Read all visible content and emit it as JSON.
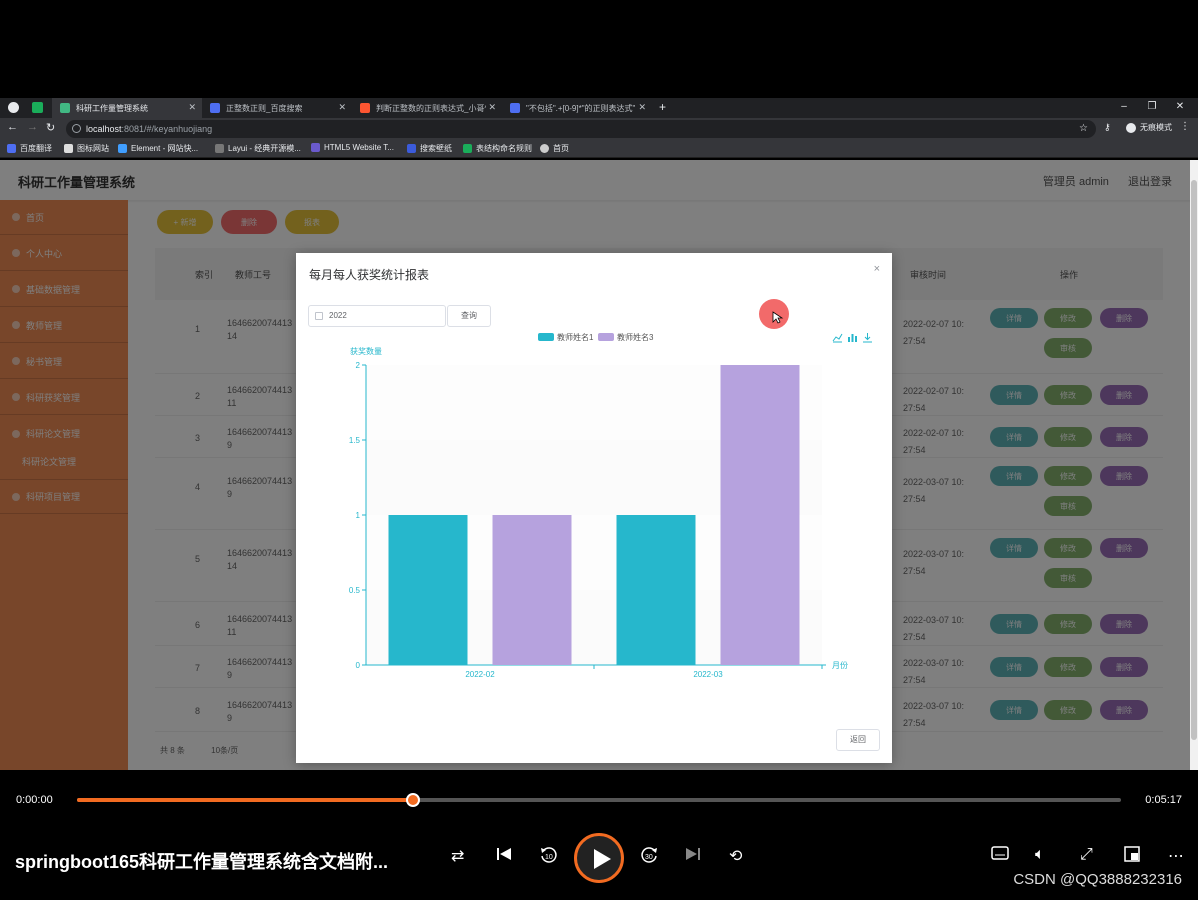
{
  "browser": {
    "tabs": [
      {
        "label": "科研工作量管理系统",
        "active": true
      },
      {
        "label": "正整数正则_百度搜索"
      },
      {
        "label": "判断正整数的正则表达式_小哥^_"
      },
      {
        "label": "\"不包括\".+[0-9]*\"的正则表达式\""
      }
    ],
    "new_tab": "+",
    "url_host": "localhost",
    "url_path": ":8081/#/keyanhuojiang",
    "incognito": "无痕模式",
    "bookmarks": [
      "百度翻译",
      "图标网站",
      "Element - 网站快...",
      "Layui - 经典开源模...",
      "HTML5 Website T...",
      "搜索壁纸",
      "表结构命名规则",
      "首页"
    ]
  },
  "app": {
    "title": "科研工作量管理系统",
    "user": "管理员 admin",
    "logout": "退出登录",
    "menu": [
      "首页",
      "个人中心",
      "基础数据管理",
      "教师管理",
      "秘书管理",
      "科研获奖管理",
      "科研论文管理",
      "科研论文管理",
      "科研项目管理"
    ],
    "toolbar": {
      "add": "+ 新增",
      "delete": "删除",
      "report": "报表"
    },
    "table": {
      "headers": {
        "index": "索引",
        "teacher_no": "教师工号",
        "audit_time": "审核时间",
        "ops": "操作"
      },
      "rows": [
        {
          "idx": "1",
          "no1": "1646620074413",
          "no2": "14",
          "t1": "2022-02-07 10:",
          "t2": "27:54",
          "review": true
        },
        {
          "idx": "2",
          "no1": "1646620074413",
          "no2": "11",
          "t1": "2022-02-07 10:",
          "t2": "27:54",
          "review": false
        },
        {
          "idx": "3",
          "no1": "1646620074413",
          "no2": "9",
          "t1": "2022-02-07 10:",
          "t2": "27:54",
          "review": false
        },
        {
          "idx": "4",
          "no1": "1646620074413",
          "no2": "9",
          "t1": "2022-03-07 10:",
          "t2": "27:54",
          "review": true
        },
        {
          "idx": "5",
          "no1": "1646620074413",
          "no2": "14",
          "t1": "2022-03-07 10:",
          "t2": "27:54",
          "review": true
        },
        {
          "idx": "6",
          "no1": "1646620074413",
          "no2": "11",
          "t1": "2022-03-07 10:",
          "t2": "27:54",
          "review": false
        },
        {
          "idx": "7",
          "no1": "1646620074413",
          "no2": "9",
          "t1": "2022-03-07 10:",
          "t2": "27:54",
          "review": false
        },
        {
          "idx": "8",
          "no1": "1646620074413",
          "no2": "9",
          "t1": "2022-03-07 10:",
          "t2": "27:54",
          "review": false
        }
      ],
      "actions": {
        "detail": "详情",
        "edit": "修改",
        "delete": "删除",
        "review": "审核"
      },
      "pager": {
        "total": "共 8 条",
        "per_page": "10条/页"
      }
    }
  },
  "dialog": {
    "title": "每月每人获奖统计报表",
    "close": "×",
    "year_value": "2022",
    "query": "查询",
    "return": "返回"
  },
  "chart_data": {
    "type": "bar",
    "categories": [
      "2022-02",
      "2022-03"
    ],
    "series": [
      {
        "name": "教师姓名1",
        "values": [
          1,
          1
        ],
        "color": "#26b7cc"
      },
      {
        "name": "教师姓名3",
        "values": [
          1,
          2
        ],
        "color": "#b6a2de"
      }
    ],
    "xlabel": "月份",
    "ylabel": "获奖数量",
    "ylim": [
      0,
      2
    ],
    "yticks": [
      "0",
      "0.5",
      "1",
      "1.5",
      "2"
    ],
    "grid": "alternating bands",
    "legend": "top-center"
  },
  "player": {
    "time_current": "0:00:00",
    "time_total": "0:05:17",
    "progress": 0.322,
    "title": "springboot165科研工作量管理系统含文档附...",
    "watermark": "CSDN @QQ3888232316",
    "accent": "#f26b21"
  }
}
